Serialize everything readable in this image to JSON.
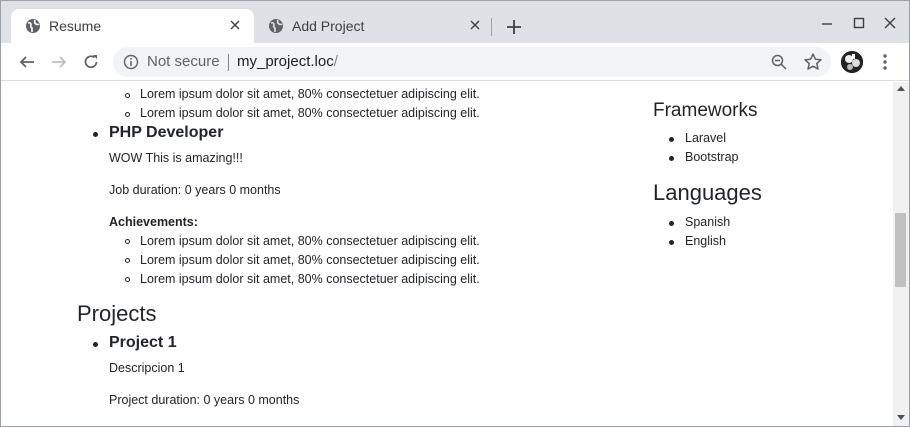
{
  "tabs": [
    {
      "title": "Resume",
      "active": true,
      "favicon": "globe-icon"
    },
    {
      "title": "Add Project",
      "active": false,
      "favicon": "globe-icon"
    }
  ],
  "toolbar": {
    "security_label": "Not secure",
    "url_host": "my_project.loc",
    "url_path": "/"
  },
  "content": {
    "prev_job_achievements_tail": [
      "Lorem ipsum dolor sit amet, 80% consectetuer adipiscing elit.",
      "Lorem ipsum dolor sit amet, 80% consectetuer adipiscing elit."
    ],
    "job": {
      "title": "PHP Developer",
      "description": "WOW This is amazing!!!",
      "duration": "Job duration: 0 years 0 months",
      "achievements_label": "Achievements:",
      "achievements": [
        "Lorem ipsum dolor sit amet, 80% consectetuer adipiscing elit.",
        "Lorem ipsum dolor sit amet, 80% consectetuer adipiscing elit.",
        "Lorem ipsum dolor sit amet, 80% consectetuer adipiscing elit."
      ]
    },
    "projects_heading": "Projects",
    "project": {
      "title": "Project 1",
      "description": "Descripcion 1",
      "duration": "Project duration: 0 years 0 months"
    },
    "sidebar": {
      "frameworks_heading": "Frameworks",
      "frameworks": [
        "Laravel",
        "Bootstrap"
      ],
      "languages_heading": "Languages",
      "languages": [
        "Spanish",
        "English"
      ]
    }
  }
}
